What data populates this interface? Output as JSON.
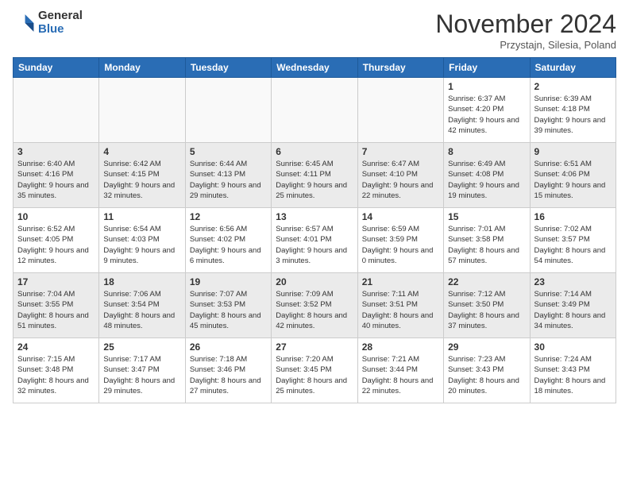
{
  "logo": {
    "general": "General",
    "blue": "Blue"
  },
  "title": "November 2024",
  "location": "Przystajn, Silesia, Poland",
  "days_of_week": [
    "Sunday",
    "Monday",
    "Tuesday",
    "Wednesday",
    "Thursday",
    "Friday",
    "Saturday"
  ],
  "weeks": [
    {
      "shaded": false,
      "days": [
        {
          "number": "",
          "info": "",
          "empty": true
        },
        {
          "number": "",
          "info": "",
          "empty": true
        },
        {
          "number": "",
          "info": "",
          "empty": true
        },
        {
          "number": "",
          "info": "",
          "empty": true
        },
        {
          "number": "",
          "info": "",
          "empty": true
        },
        {
          "number": "1",
          "sunrise": "6:37 AM",
          "sunset": "4:20 PM",
          "daylight": "9 hours and 42 minutes."
        },
        {
          "number": "2",
          "sunrise": "6:39 AM",
          "sunset": "4:18 PM",
          "daylight": "9 hours and 39 minutes."
        }
      ]
    },
    {
      "shaded": true,
      "days": [
        {
          "number": "3",
          "sunrise": "6:40 AM",
          "sunset": "4:16 PM",
          "daylight": "9 hours and 35 minutes."
        },
        {
          "number": "4",
          "sunrise": "6:42 AM",
          "sunset": "4:15 PM",
          "daylight": "9 hours and 32 minutes."
        },
        {
          "number": "5",
          "sunrise": "6:44 AM",
          "sunset": "4:13 PM",
          "daylight": "9 hours and 29 minutes."
        },
        {
          "number": "6",
          "sunrise": "6:45 AM",
          "sunset": "4:11 PM",
          "daylight": "9 hours and 25 minutes."
        },
        {
          "number": "7",
          "sunrise": "6:47 AM",
          "sunset": "4:10 PM",
          "daylight": "9 hours and 22 minutes."
        },
        {
          "number": "8",
          "sunrise": "6:49 AM",
          "sunset": "4:08 PM",
          "daylight": "9 hours and 19 minutes."
        },
        {
          "number": "9",
          "sunrise": "6:51 AM",
          "sunset": "4:06 PM",
          "daylight": "9 hours and 15 minutes."
        }
      ]
    },
    {
      "shaded": false,
      "days": [
        {
          "number": "10",
          "sunrise": "6:52 AM",
          "sunset": "4:05 PM",
          "daylight": "9 hours and 12 minutes."
        },
        {
          "number": "11",
          "sunrise": "6:54 AM",
          "sunset": "4:03 PM",
          "daylight": "9 hours and 9 minutes."
        },
        {
          "number": "12",
          "sunrise": "6:56 AM",
          "sunset": "4:02 PM",
          "daylight": "9 hours and 6 minutes."
        },
        {
          "number": "13",
          "sunrise": "6:57 AM",
          "sunset": "4:01 PM",
          "daylight": "9 hours and 3 minutes."
        },
        {
          "number": "14",
          "sunrise": "6:59 AM",
          "sunset": "3:59 PM",
          "daylight": "9 hours and 0 minutes."
        },
        {
          "number": "15",
          "sunrise": "7:01 AM",
          "sunset": "3:58 PM",
          "daylight": "8 hours and 57 minutes."
        },
        {
          "number": "16",
          "sunrise": "7:02 AM",
          "sunset": "3:57 PM",
          "daylight": "8 hours and 54 minutes."
        }
      ]
    },
    {
      "shaded": true,
      "days": [
        {
          "number": "17",
          "sunrise": "7:04 AM",
          "sunset": "3:55 PM",
          "daylight": "8 hours and 51 minutes."
        },
        {
          "number": "18",
          "sunrise": "7:06 AM",
          "sunset": "3:54 PM",
          "daylight": "8 hours and 48 minutes."
        },
        {
          "number": "19",
          "sunrise": "7:07 AM",
          "sunset": "3:53 PM",
          "daylight": "8 hours and 45 minutes."
        },
        {
          "number": "20",
          "sunrise": "7:09 AM",
          "sunset": "3:52 PM",
          "daylight": "8 hours and 42 minutes."
        },
        {
          "number": "21",
          "sunrise": "7:11 AM",
          "sunset": "3:51 PM",
          "daylight": "8 hours and 40 minutes."
        },
        {
          "number": "22",
          "sunrise": "7:12 AM",
          "sunset": "3:50 PM",
          "daylight": "8 hours and 37 minutes."
        },
        {
          "number": "23",
          "sunrise": "7:14 AM",
          "sunset": "3:49 PM",
          "daylight": "8 hours and 34 minutes."
        }
      ]
    },
    {
      "shaded": false,
      "days": [
        {
          "number": "24",
          "sunrise": "7:15 AM",
          "sunset": "3:48 PM",
          "daylight": "8 hours and 32 minutes."
        },
        {
          "number": "25",
          "sunrise": "7:17 AM",
          "sunset": "3:47 PM",
          "daylight": "8 hours and 29 minutes."
        },
        {
          "number": "26",
          "sunrise": "7:18 AM",
          "sunset": "3:46 PM",
          "daylight": "8 hours and 27 minutes."
        },
        {
          "number": "27",
          "sunrise": "7:20 AM",
          "sunset": "3:45 PM",
          "daylight": "8 hours and 25 minutes."
        },
        {
          "number": "28",
          "sunrise": "7:21 AM",
          "sunset": "3:44 PM",
          "daylight": "8 hours and 22 minutes."
        },
        {
          "number": "29",
          "sunrise": "7:23 AM",
          "sunset": "3:43 PM",
          "daylight": "8 hours and 20 minutes."
        },
        {
          "number": "30",
          "sunrise": "7:24 AM",
          "sunset": "3:43 PM",
          "daylight": "8 hours and 18 minutes."
        }
      ]
    }
  ]
}
